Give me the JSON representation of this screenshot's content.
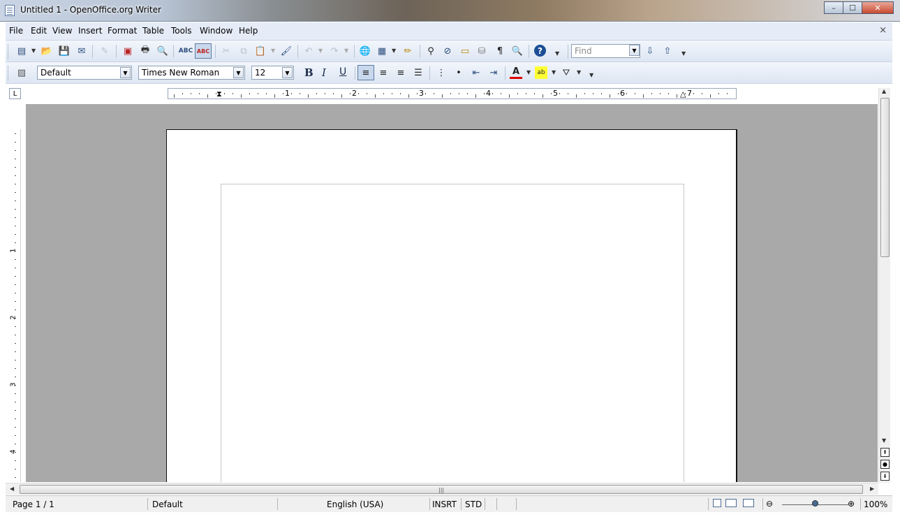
{
  "window": {
    "title": "Untitled 1 - OpenOffice.org Writer",
    "minimize": "–",
    "maximize": "☐",
    "close": "✕"
  },
  "menubar": {
    "items": [
      "File",
      "Edit",
      "View",
      "Insert",
      "Format",
      "Table",
      "Tools",
      "Window",
      "Help"
    ],
    "close_doc": "×"
  },
  "standard_toolbar": {
    "find_placeholder": "Find"
  },
  "formatting_toolbar": {
    "paragraph_style": "Default",
    "font_name": "Times New Roman",
    "font_size": "12",
    "bold": "B",
    "italic": "I",
    "underline": "U"
  },
  "ruler": {
    "h_numbers": [
      "1",
      "2",
      "3",
      "4",
      "5",
      "6",
      "7"
    ],
    "v_numbers": [
      "1",
      "2",
      "3",
      "4"
    ],
    "tab_type": "L"
  },
  "statusbar": {
    "page": "Page 1 / 1",
    "page_style": "Default",
    "language": "English (USA)",
    "insert_mode": "INSRT",
    "selection_mode": "STD",
    "zoom": "100%"
  }
}
